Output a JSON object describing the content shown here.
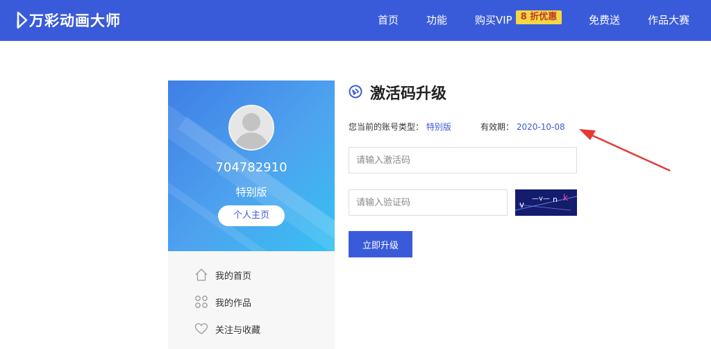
{
  "brand": {
    "name": "万彩动画大师",
    "icon": "logo-play-icon"
  },
  "nav": {
    "items": [
      "首页",
      "功能",
      "购买VIP",
      "免费送",
      "作品大赛"
    ],
    "vip_badge": "8 折优惠"
  },
  "profile": {
    "user_id": "704782910",
    "account_type": "特别版",
    "homepage_button": "个人主页",
    "avatar_icon": "default-avatar-icon"
  },
  "side_menu": [
    {
      "label": "我的首页",
      "icon": "home-icon"
    },
    {
      "label": "我的作品",
      "icon": "grid-circles-icon"
    },
    {
      "label": "关注与收藏",
      "icon": "heart-icon"
    }
  ],
  "main": {
    "title": "激活码升级",
    "title_icon": "upgrade-badge-icon",
    "account_type_label": "您当前的账号类型：",
    "account_type_value": "特别版",
    "expiry_label": "有效期：",
    "expiry_value": "2020-10-08",
    "activation_placeholder": "请输入激活码",
    "captcha_placeholder": "请输入验证码",
    "captcha_text": "v —v— n k",
    "submit_label": "立即升级"
  },
  "colors": {
    "accent": "#3a5bd9",
    "annotation_arrow": "#e53935",
    "badge": "#f5d743"
  }
}
